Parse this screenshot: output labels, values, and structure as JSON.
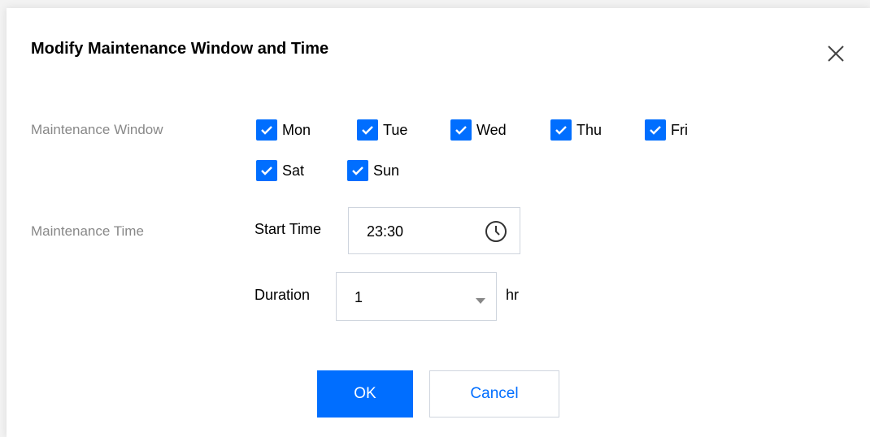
{
  "dialog": {
    "title": "Modify Maintenance Window and Time",
    "close_icon": "close-icon"
  },
  "maintenance_window": {
    "label": "Maintenance Window",
    "days": [
      {
        "label": "Mon",
        "checked": true
      },
      {
        "label": "Tue",
        "checked": true
      },
      {
        "label": "Wed",
        "checked": true
      },
      {
        "label": "Thu",
        "checked": true
      },
      {
        "label": "Fri",
        "checked": true
      },
      {
        "label": "Sat",
        "checked": true
      },
      {
        "label": "Sun",
        "checked": true
      }
    ]
  },
  "maintenance_time": {
    "label": "Maintenance Time",
    "start_time_label": "Start Time",
    "start_time_value": "23:30",
    "start_time_icon": "clock-icon",
    "duration_label": "Duration",
    "duration_value": "1",
    "duration_icon": "caret-down-icon",
    "duration_unit": "hr"
  },
  "buttons": {
    "ok_label": "OK",
    "cancel_label": "Cancel"
  },
  "colors": {
    "accent": "#006eff",
    "label_gray": "#888888",
    "border": "#cfd5de"
  }
}
